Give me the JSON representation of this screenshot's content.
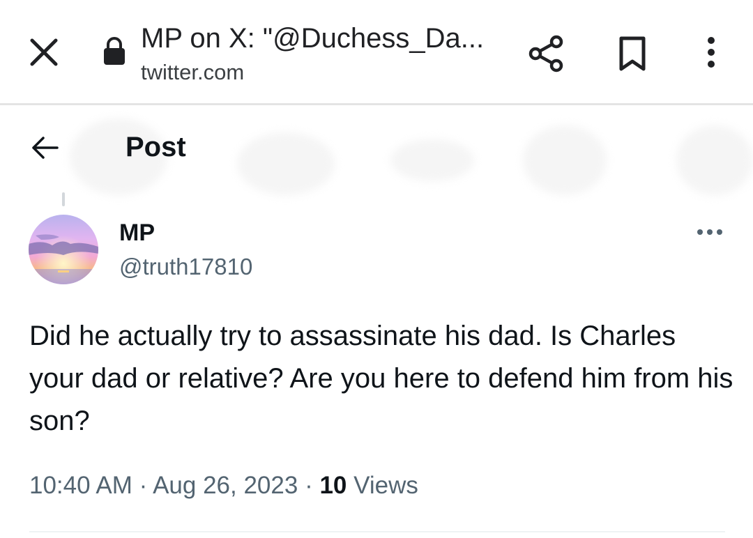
{
  "browser": {
    "title": "MP on X: \"@Duchess_Da...",
    "domain": "twitter.com"
  },
  "header": {
    "title": "Post"
  },
  "tweet": {
    "display_name": "MP",
    "handle": "@truth17810",
    "text": "Did he actually try to assassinate his dad. Is Charles your dad or relative? Are you here to defend him from his son?",
    "time": "10:40 AM",
    "separator": "·",
    "date": "Aug 26, 2023",
    "views_count": "10",
    "views_label": "Views"
  },
  "icons": {
    "close": "close-icon",
    "lock": "lock-icon",
    "share": "share-icon",
    "bookmark": "bookmark-icon",
    "menu": "vertical-dots-icon",
    "back": "back-arrow-icon",
    "more": "horizontal-dots-icon"
  },
  "colors": {
    "text_primary": "#0f1419",
    "text_secondary": "#536471",
    "browser_text": "#202124"
  }
}
